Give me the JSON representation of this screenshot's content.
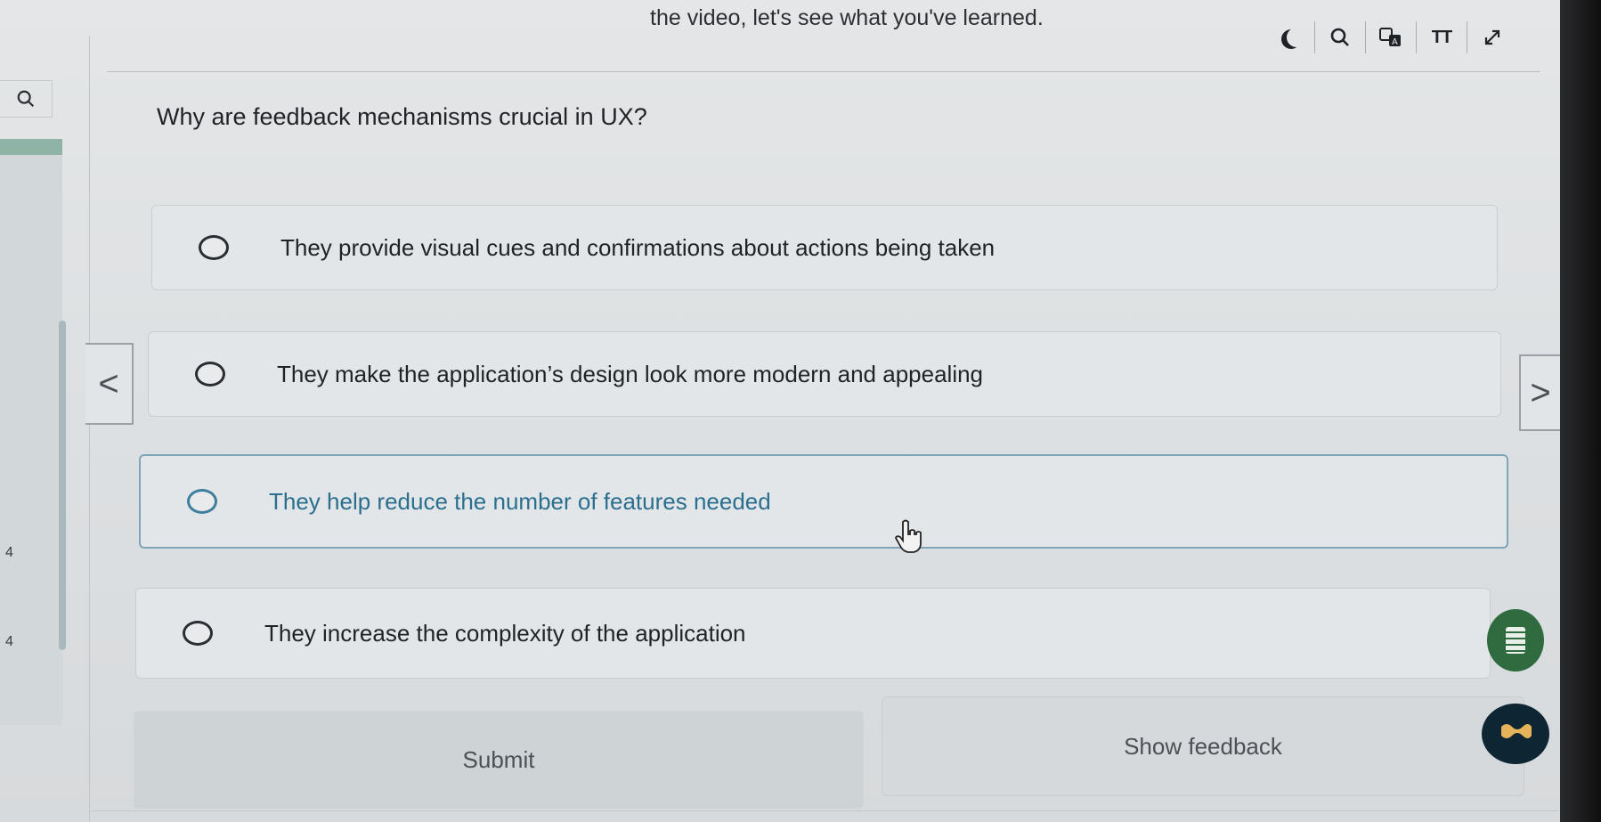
{
  "header": {
    "hint": "the video, let's see what you've learned.",
    "tools": [
      {
        "name": "dark-mode",
        "icon": "moon-icon"
      },
      {
        "name": "search",
        "icon": "search-icon"
      },
      {
        "name": "translate",
        "icon": "translate-icon"
      },
      {
        "name": "text-size",
        "icon": "text-size-icon",
        "label": "TT"
      },
      {
        "name": "expand",
        "icon": "expand-icon"
      }
    ]
  },
  "sidebar": {
    "search_icon": "search-icon",
    "page_numbers": [
      "4",
      "4"
    ]
  },
  "quiz": {
    "question": "Why are feedback mechanisms crucial in UX?",
    "options": [
      {
        "label": "They provide visual cues and confirmations about actions being taken"
      },
      {
        "label": "They make the application’s design look more modern and appealing"
      },
      {
        "label": "They help reduce the number of features needed",
        "hovered": true
      },
      {
        "label": "They increase the complexity of the application"
      }
    ],
    "submit_label": "Submit",
    "feedback_label": "Show feedback"
  },
  "nav": {
    "prev": "<",
    "next": ">"
  },
  "floating": {
    "notes_icon": "notes-icon",
    "chat_icon": "chat-icon"
  },
  "colors": {
    "accent": "#2b6f8e",
    "notes_bg": "#2f6b3f",
    "chat_bg": "#0e2633"
  }
}
